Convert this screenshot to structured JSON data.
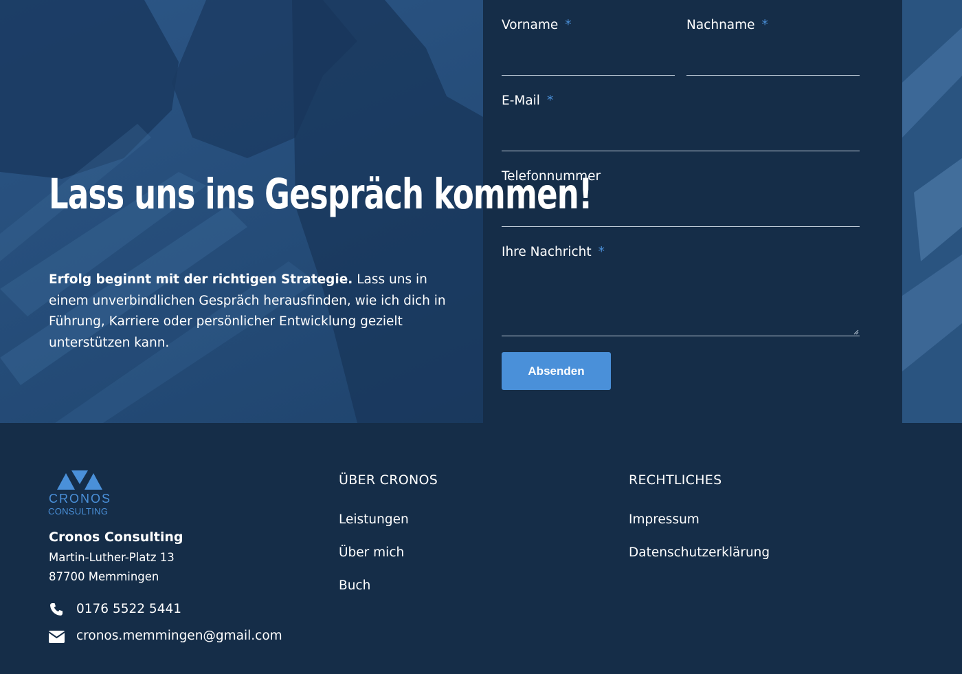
{
  "hero": {
    "title": "Lass uns ins Gespräch kommen!",
    "text_bold": "Erfolg beginnt mit der richtigen Strategie.",
    "text": " Lass uns in einem unverbindlichen Gespräch herausfinden, wie ich dich in Führung, Karriere oder persönlicher Entwicklung gezielt unterstützen kann."
  },
  "form": {
    "required_marker": "*",
    "fields": {
      "vorname": "Vorname",
      "nachname": "Nachname",
      "email": "E-Mail",
      "telefon": "Telefonnummer",
      "nachricht": "Ihre Nachricht"
    },
    "submit_label": "Absenden"
  },
  "footer": {
    "logo_word": "CRONOS",
    "logo_sub": "CONSULTING",
    "company": "Cronos Consulting",
    "street": "Martin-Luther-Platz 13",
    "city": "87700 Memmingen",
    "phone": "0176 5522 5441",
    "email": "cronos.memmingen@gmail.com",
    "col1": {
      "heading": "ÜBER CRONOS",
      "links": [
        "Leistungen",
        "Über mich",
        "Buch"
      ]
    },
    "col2": {
      "heading": "RECHTLICHES",
      "links": [
        "Impressum",
        "Datenschutzerklärung"
      ]
    }
  },
  "colors": {
    "background": "#152d48",
    "accent": "#4a90d9",
    "hero_overlay": "#1f4570"
  }
}
